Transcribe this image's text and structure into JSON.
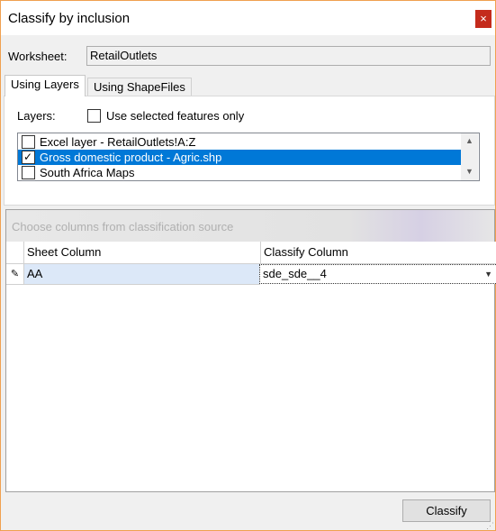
{
  "window": {
    "title": "Classify by inclusion",
    "close_glyph": "×"
  },
  "worksheet": {
    "label": "Worksheet:",
    "value": "RetailOutlets"
  },
  "tabs": [
    {
      "label": "Using Layers",
      "active": true
    },
    {
      "label": "Using ShapeFiles",
      "active": false
    }
  ],
  "layers": {
    "label": "Layers:",
    "use_selected_label": "Use selected features only",
    "use_selected_checked": false,
    "items": [
      {
        "label": "Excel layer - RetailOutlets!A:Z",
        "checked": false,
        "selected": false
      },
      {
        "label": "Gross domestic product - Agric.shp",
        "checked": true,
        "selected": true
      },
      {
        "label": "South Africa Maps",
        "checked": false,
        "selected": false
      }
    ]
  },
  "grid": {
    "caption": "Choose columns from classification source",
    "headers": [
      "Sheet Column",
      "Classify Column"
    ],
    "rows": [
      {
        "sheet_column": "AA",
        "classify_column": "sde_sde__4"
      }
    ]
  },
  "buttons": {
    "classify": "Classify"
  },
  "colors": {
    "selection": "#0078d7",
    "close": "#c42b1c",
    "border_accent": "#f0a050"
  }
}
